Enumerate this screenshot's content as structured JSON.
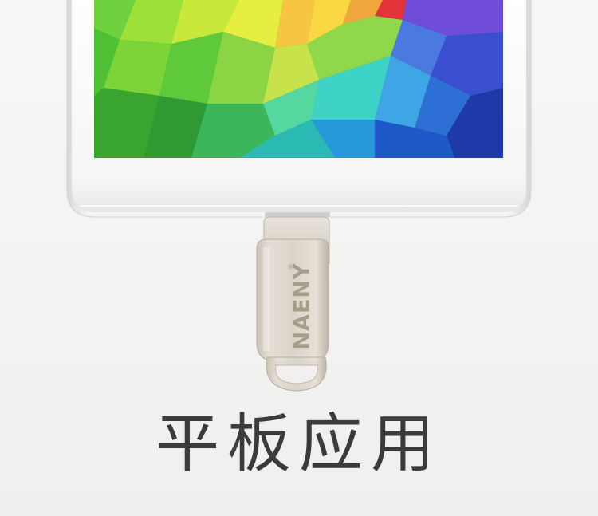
{
  "product": {
    "brand_logo_text": "NAENY",
    "registered_mark": "®"
  },
  "caption": {
    "text": "平板应用"
  },
  "colors": {
    "background": "#f3f3f2",
    "tablet_body": "#fbfbfb",
    "flash_drive_metal": "#d8d2c6",
    "logo_engraving": "#a79d8b",
    "caption_text": "#3b3b3b"
  }
}
